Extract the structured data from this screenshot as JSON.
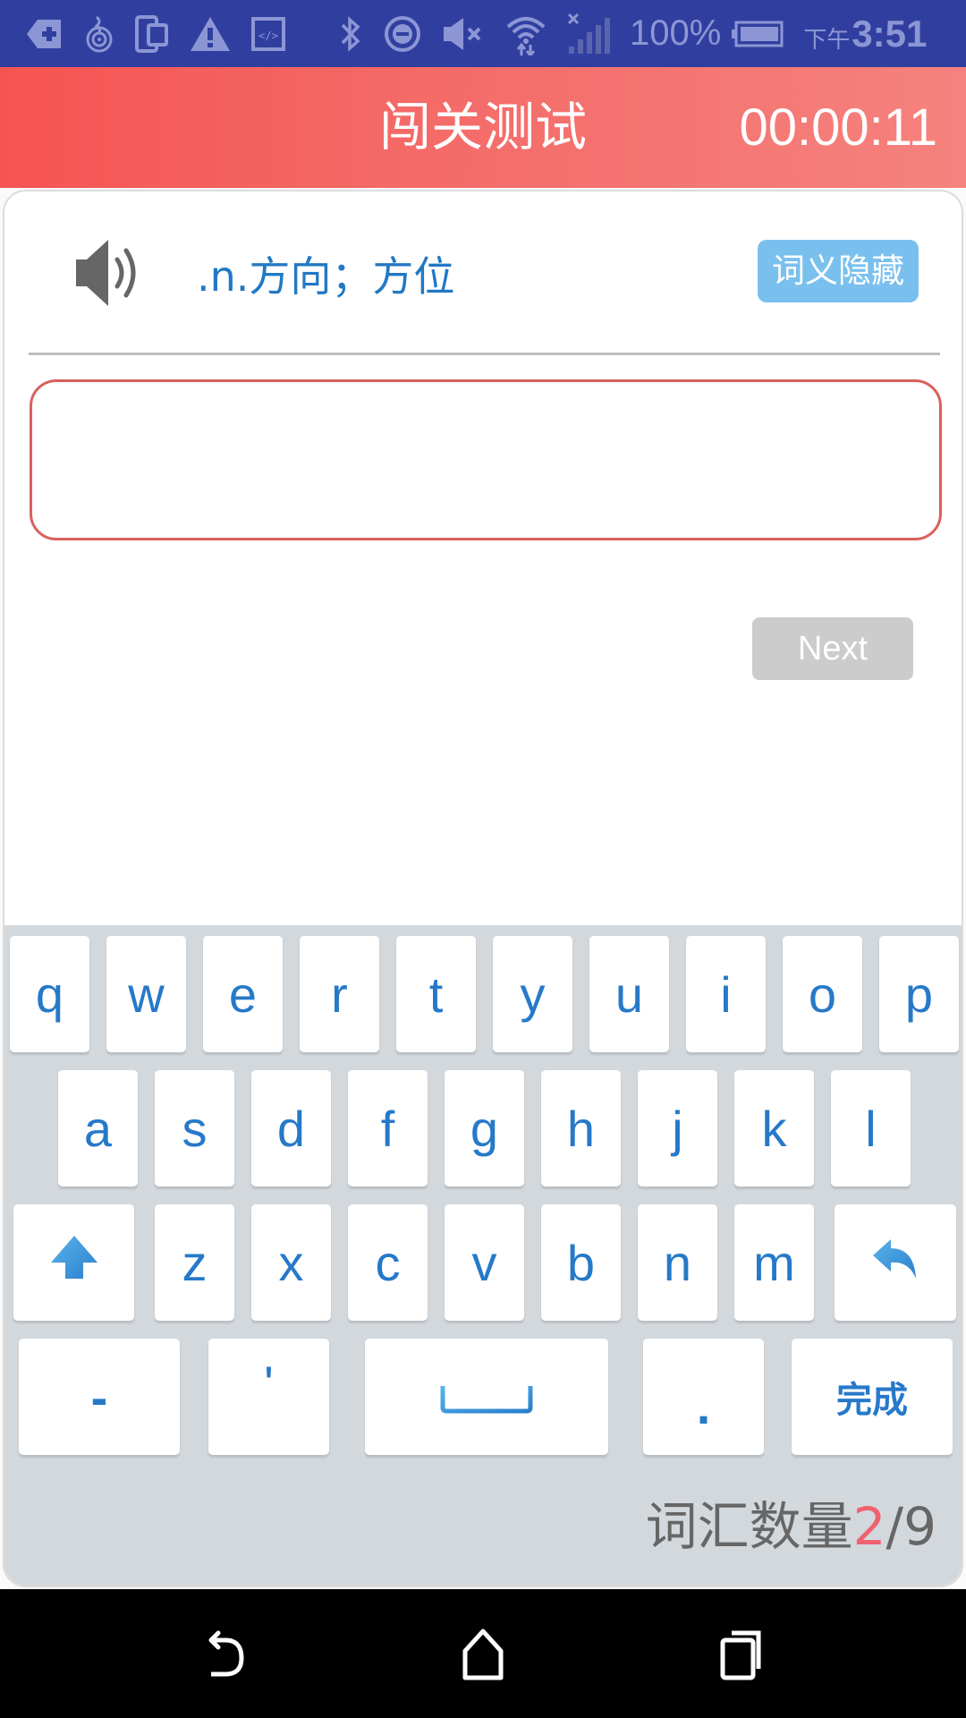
{
  "status_bar": {
    "icons": [
      "notification-plus-icon",
      "hotspot-icon",
      "device-icon",
      "warning-icon",
      "code-icon",
      "bluetooth-icon",
      "do-not-disturb-icon",
      "volume-muted-icon",
      "wifi-icon",
      "signal-no-service-icon",
      "battery-icon"
    ],
    "battery": "100%",
    "time_prefix": "下午",
    "time": "3:51"
  },
  "header": {
    "title": "闯关测试",
    "timer": "00:00:11"
  },
  "word": {
    "speaker_icon": "speaker-icon",
    "meaning": ".n.方向；方位",
    "hide_meaning_label": "词义隐藏"
  },
  "answer": {
    "value": "",
    "placeholder": ""
  },
  "next_label": "Next",
  "keyboard": {
    "row1": [
      "q",
      "w",
      "e",
      "r",
      "t",
      "y",
      "u",
      "i",
      "o",
      "p"
    ],
    "row2": [
      "a",
      "s",
      "d",
      "f",
      "g",
      "h",
      "j",
      "k",
      "l"
    ],
    "row3": [
      "z",
      "x",
      "c",
      "v",
      "b",
      "n",
      "m"
    ],
    "shift_icon": "shift-arrow-icon",
    "backspace_icon": "backspace-arrow-icon",
    "row4": {
      "hyphen": "-",
      "apostrophe": "'",
      "space_icon": "space-bar-icon",
      "period": ".",
      "done": "完成"
    }
  },
  "counter": {
    "label": "词汇数量",
    "current": "2",
    "separator": "/",
    "total": "9"
  },
  "colors": {
    "status_bar": "#303f9f",
    "header_start": "#f55452",
    "header_end": "#f5827e",
    "accent_blue": "#2679c9",
    "hide_button": "#7ac0ee",
    "input_border": "#d9615c",
    "next_disabled": "#cccccc",
    "counter_current": "#f0616f"
  },
  "nav_bar": {
    "back_icon": "back-icon",
    "home_icon": "home-icon",
    "recents_icon": "recents-icon"
  }
}
